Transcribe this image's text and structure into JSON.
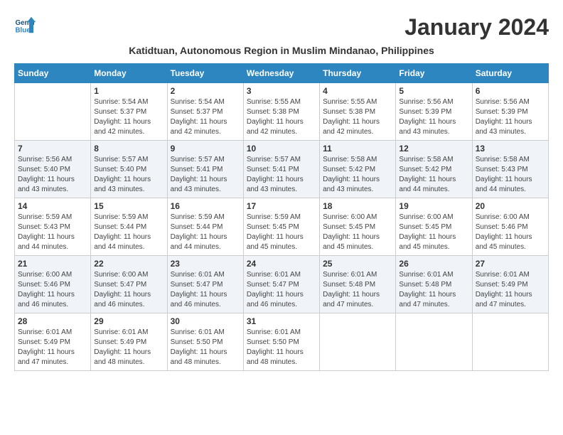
{
  "header": {
    "logo_line1": "General",
    "logo_line2": "Blue",
    "month_title": "January 2024",
    "subtitle": "Katidtuan, Autonomous Region in Muslim Mindanao, Philippines"
  },
  "days_of_week": [
    "Sunday",
    "Monday",
    "Tuesday",
    "Wednesday",
    "Thursday",
    "Friday",
    "Saturday"
  ],
  "weeks": [
    {
      "cells": [
        {
          "day": "",
          "sunrise": "",
          "sunset": "",
          "daylight": ""
        },
        {
          "day": "1",
          "sunrise": "Sunrise: 5:54 AM",
          "sunset": "Sunset: 5:37 PM",
          "daylight": "Daylight: 11 hours and 42 minutes."
        },
        {
          "day": "2",
          "sunrise": "Sunrise: 5:54 AM",
          "sunset": "Sunset: 5:37 PM",
          "daylight": "Daylight: 11 hours and 42 minutes."
        },
        {
          "day": "3",
          "sunrise": "Sunrise: 5:55 AM",
          "sunset": "Sunset: 5:38 PM",
          "daylight": "Daylight: 11 hours and 42 minutes."
        },
        {
          "day": "4",
          "sunrise": "Sunrise: 5:55 AM",
          "sunset": "Sunset: 5:38 PM",
          "daylight": "Daylight: 11 hours and 42 minutes."
        },
        {
          "day": "5",
          "sunrise": "Sunrise: 5:56 AM",
          "sunset": "Sunset: 5:39 PM",
          "daylight": "Daylight: 11 hours and 43 minutes."
        },
        {
          "day": "6",
          "sunrise": "Sunrise: 5:56 AM",
          "sunset": "Sunset: 5:39 PM",
          "daylight": "Daylight: 11 hours and 43 minutes."
        }
      ]
    },
    {
      "cells": [
        {
          "day": "7",
          "sunrise": "Sunrise: 5:56 AM",
          "sunset": "Sunset: 5:40 PM",
          "daylight": "Daylight: 11 hours and 43 minutes."
        },
        {
          "day": "8",
          "sunrise": "Sunrise: 5:57 AM",
          "sunset": "Sunset: 5:40 PM",
          "daylight": "Daylight: 11 hours and 43 minutes."
        },
        {
          "day": "9",
          "sunrise": "Sunrise: 5:57 AM",
          "sunset": "Sunset: 5:41 PM",
          "daylight": "Daylight: 11 hours and 43 minutes."
        },
        {
          "day": "10",
          "sunrise": "Sunrise: 5:57 AM",
          "sunset": "Sunset: 5:41 PM",
          "daylight": "Daylight: 11 hours and 43 minutes."
        },
        {
          "day": "11",
          "sunrise": "Sunrise: 5:58 AM",
          "sunset": "Sunset: 5:42 PM",
          "daylight": "Daylight: 11 hours and 43 minutes."
        },
        {
          "day": "12",
          "sunrise": "Sunrise: 5:58 AM",
          "sunset": "Sunset: 5:42 PM",
          "daylight": "Daylight: 11 hours and 44 minutes."
        },
        {
          "day": "13",
          "sunrise": "Sunrise: 5:58 AM",
          "sunset": "Sunset: 5:43 PM",
          "daylight": "Daylight: 11 hours and 44 minutes."
        }
      ]
    },
    {
      "cells": [
        {
          "day": "14",
          "sunrise": "Sunrise: 5:59 AM",
          "sunset": "Sunset: 5:43 PM",
          "daylight": "Daylight: 11 hours and 44 minutes."
        },
        {
          "day": "15",
          "sunrise": "Sunrise: 5:59 AM",
          "sunset": "Sunset: 5:44 PM",
          "daylight": "Daylight: 11 hours and 44 minutes."
        },
        {
          "day": "16",
          "sunrise": "Sunrise: 5:59 AM",
          "sunset": "Sunset: 5:44 PM",
          "daylight": "Daylight: 11 hours and 44 minutes."
        },
        {
          "day": "17",
          "sunrise": "Sunrise: 5:59 AM",
          "sunset": "Sunset: 5:45 PM",
          "daylight": "Daylight: 11 hours and 45 minutes."
        },
        {
          "day": "18",
          "sunrise": "Sunrise: 6:00 AM",
          "sunset": "Sunset: 5:45 PM",
          "daylight": "Daylight: 11 hours and 45 minutes."
        },
        {
          "day": "19",
          "sunrise": "Sunrise: 6:00 AM",
          "sunset": "Sunset: 5:45 PM",
          "daylight": "Daylight: 11 hours and 45 minutes."
        },
        {
          "day": "20",
          "sunrise": "Sunrise: 6:00 AM",
          "sunset": "Sunset: 5:46 PM",
          "daylight": "Daylight: 11 hours and 45 minutes."
        }
      ]
    },
    {
      "cells": [
        {
          "day": "21",
          "sunrise": "Sunrise: 6:00 AM",
          "sunset": "Sunset: 5:46 PM",
          "daylight": "Daylight: 11 hours and 46 minutes."
        },
        {
          "day": "22",
          "sunrise": "Sunrise: 6:00 AM",
          "sunset": "Sunset: 5:47 PM",
          "daylight": "Daylight: 11 hours and 46 minutes."
        },
        {
          "day": "23",
          "sunrise": "Sunrise: 6:01 AM",
          "sunset": "Sunset: 5:47 PM",
          "daylight": "Daylight: 11 hours and 46 minutes."
        },
        {
          "day": "24",
          "sunrise": "Sunrise: 6:01 AM",
          "sunset": "Sunset: 5:47 PM",
          "daylight": "Daylight: 11 hours and 46 minutes."
        },
        {
          "day": "25",
          "sunrise": "Sunrise: 6:01 AM",
          "sunset": "Sunset: 5:48 PM",
          "daylight": "Daylight: 11 hours and 47 minutes."
        },
        {
          "day": "26",
          "sunrise": "Sunrise: 6:01 AM",
          "sunset": "Sunset: 5:48 PM",
          "daylight": "Daylight: 11 hours and 47 minutes."
        },
        {
          "day": "27",
          "sunrise": "Sunrise: 6:01 AM",
          "sunset": "Sunset: 5:49 PM",
          "daylight": "Daylight: 11 hours and 47 minutes."
        }
      ]
    },
    {
      "cells": [
        {
          "day": "28",
          "sunrise": "Sunrise: 6:01 AM",
          "sunset": "Sunset: 5:49 PM",
          "daylight": "Daylight: 11 hours and 47 minutes."
        },
        {
          "day": "29",
          "sunrise": "Sunrise: 6:01 AM",
          "sunset": "Sunset: 5:49 PM",
          "daylight": "Daylight: 11 hours and 48 minutes."
        },
        {
          "day": "30",
          "sunrise": "Sunrise: 6:01 AM",
          "sunset": "Sunset: 5:50 PM",
          "daylight": "Daylight: 11 hours and 48 minutes."
        },
        {
          "day": "31",
          "sunrise": "Sunrise: 6:01 AM",
          "sunset": "Sunset: 5:50 PM",
          "daylight": "Daylight: 11 hours and 48 minutes."
        },
        {
          "day": "",
          "sunrise": "",
          "sunset": "",
          "daylight": ""
        },
        {
          "day": "",
          "sunrise": "",
          "sunset": "",
          "daylight": ""
        },
        {
          "day": "",
          "sunrise": "",
          "sunset": "",
          "daylight": ""
        }
      ]
    }
  ]
}
